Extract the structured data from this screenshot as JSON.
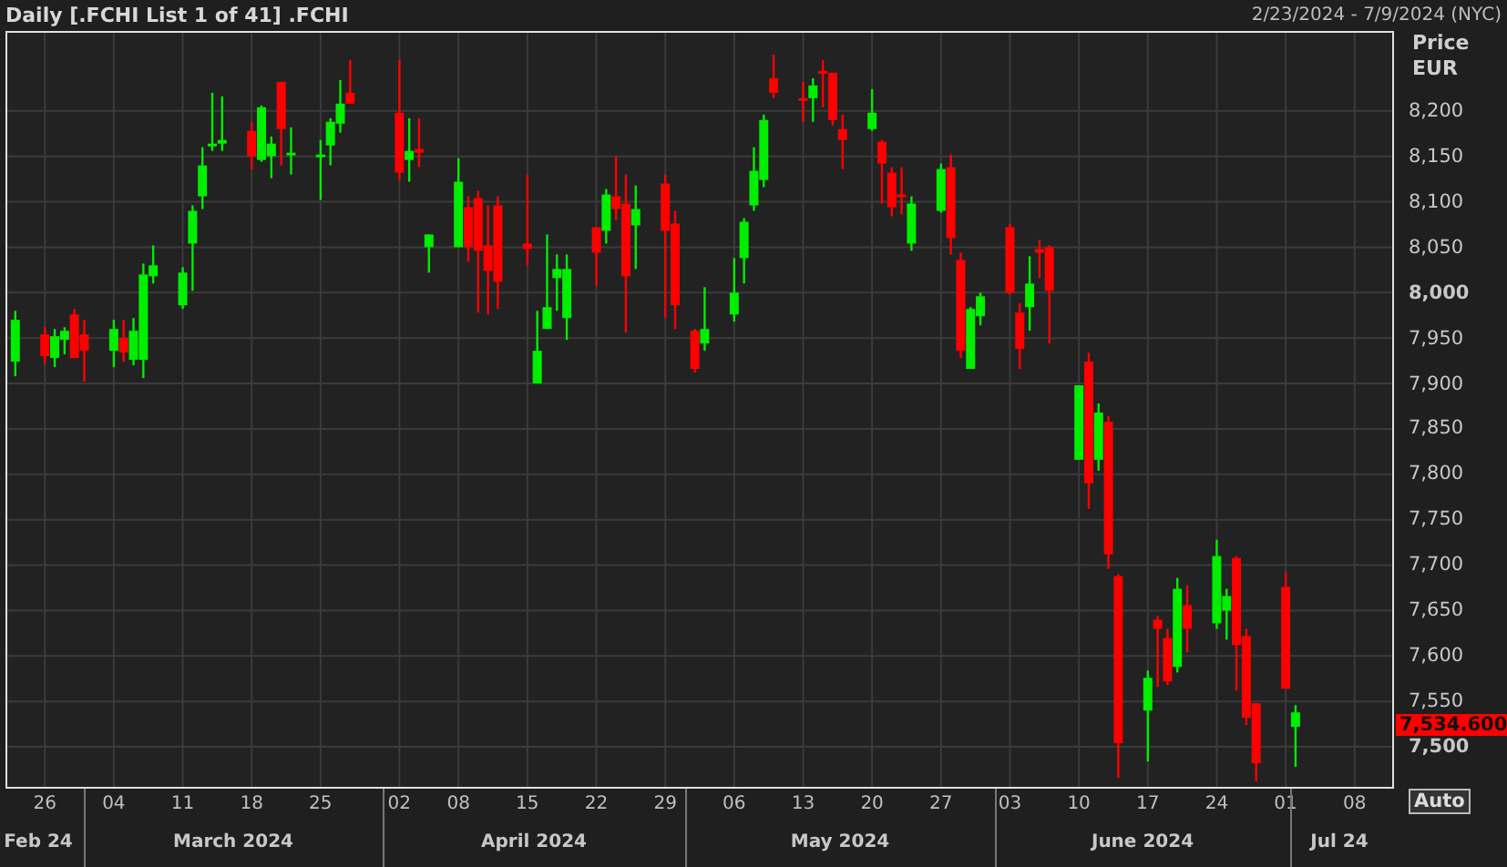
{
  "title": "Daily [.FCHI List 1 of 41] .FCHI",
  "date_range": "2/23/2024 - 7/9/2024 (NYC)",
  "price_axis": {
    "title": "Price",
    "unit": "EUR",
    "tick_styles": [
      {
        "emphasized": false
      },
      {
        "emphasized": false
      },
      {
        "emphasized": false
      },
      {
        "emphasized": false
      },
      {
        "emphasized": true
      },
      {
        "emphasized": false
      },
      {
        "emphasized": false
      },
      {
        "emphasized": false
      },
      {
        "emphasized": false
      },
      {
        "emphasized": false
      },
      {
        "emphasized": false
      },
      {
        "emphasized": false
      },
      {
        "emphasized": false
      },
      {
        "emphasized": false
      },
      {
        "emphasized": true
      }
    ]
  },
  "last_price": "7,534.600",
  "chart_data": {
    "type": "candlestick",
    "grid": true,
    "xlim": [
      "2024-02-22",
      "2024-07-12"
    ],
    "ylim": [
      7454,
      8288
    ],
    "yticks": [
      {
        "value": 8200,
        "label": "8,200"
      },
      {
        "value": 8150,
        "label": "8,150"
      },
      {
        "value": 8100,
        "label": "8,100"
      },
      {
        "value": 8050,
        "label": "8,050"
      },
      {
        "value": 8000,
        "label": "8,000"
      },
      {
        "value": 7950,
        "label": "7,950"
      },
      {
        "value": 7900,
        "label": "7,900"
      },
      {
        "value": 7850,
        "label": "7,850"
      },
      {
        "value": 7800,
        "label": "7,800"
      },
      {
        "value": 7750,
        "label": "7,750"
      },
      {
        "value": 7700,
        "label": "7,700"
      },
      {
        "value": 7650,
        "label": "7,650"
      },
      {
        "value": 7600,
        "label": "7,600"
      },
      {
        "value": 7550,
        "label": "7,550"
      },
      {
        "value": 7500,
        "label": "7,500"
      }
    ],
    "xticks": [
      {
        "value": "2024-02-26",
        "label": "26"
      },
      {
        "value": "2024-03-04",
        "label": "04"
      },
      {
        "value": "2024-03-11",
        "label": "11"
      },
      {
        "value": "2024-03-18",
        "label": "18"
      },
      {
        "value": "2024-03-25",
        "label": "25"
      },
      {
        "value": "2024-04-02",
        "label": "02"
      },
      {
        "value": "2024-04-08",
        "label": "08"
      },
      {
        "value": "2024-04-15",
        "label": "15"
      },
      {
        "value": "2024-04-22",
        "label": "22"
      },
      {
        "value": "2024-04-29",
        "label": "29"
      },
      {
        "value": "2024-05-06",
        "label": "06"
      },
      {
        "value": "2024-05-13",
        "label": "13"
      },
      {
        "value": "2024-05-20",
        "label": "20"
      },
      {
        "value": "2024-05-27",
        "label": "27"
      },
      {
        "value": "2024-06-03",
        "label": "03"
      },
      {
        "value": "2024-06-10",
        "label": "10"
      },
      {
        "value": "2024-06-17",
        "label": "17"
      },
      {
        "value": "2024-06-24",
        "label": "24"
      },
      {
        "value": "2024-07-01",
        "label": "01"
      },
      {
        "value": "2024-07-08",
        "label": "08"
      }
    ],
    "x": [
      "2024-02-23",
      "2024-02-26",
      "2024-02-27",
      "2024-02-28",
      "2024-02-29",
      "2024-03-01",
      "2024-03-04",
      "2024-03-05",
      "2024-03-06",
      "2024-03-07",
      "2024-03-08",
      "2024-03-11",
      "2024-03-12",
      "2024-03-13",
      "2024-03-14",
      "2024-03-15",
      "2024-03-18",
      "2024-03-19",
      "2024-03-20",
      "2024-03-21",
      "2024-03-22",
      "2024-03-25",
      "2024-03-26",
      "2024-03-27",
      "2024-03-28",
      "2024-04-02",
      "2024-04-03",
      "2024-04-04",
      "2024-04-05",
      "2024-04-08",
      "2024-04-09",
      "2024-04-10",
      "2024-04-11",
      "2024-04-12",
      "2024-04-15",
      "2024-04-16",
      "2024-04-17",
      "2024-04-18",
      "2024-04-19",
      "2024-04-22",
      "2024-04-23",
      "2024-04-24",
      "2024-04-25",
      "2024-04-26",
      "2024-04-29",
      "2024-04-30",
      "2024-05-02",
      "2024-05-03",
      "2024-05-06",
      "2024-05-07",
      "2024-05-08",
      "2024-05-09",
      "2024-05-10",
      "2024-05-13",
      "2024-05-14",
      "2024-05-15",
      "2024-05-16",
      "2024-05-17",
      "2024-05-20",
      "2024-05-21",
      "2024-05-22",
      "2024-05-23",
      "2024-05-24",
      "2024-05-27",
      "2024-05-28",
      "2024-05-29",
      "2024-05-30",
      "2024-05-31",
      "2024-06-03",
      "2024-06-04",
      "2024-06-05",
      "2024-06-06",
      "2024-06-07",
      "2024-06-10",
      "2024-06-11",
      "2024-06-12",
      "2024-06-13",
      "2024-06-14",
      "2024-06-17",
      "2024-06-18",
      "2024-06-19",
      "2024-06-20",
      "2024-06-21",
      "2024-06-24",
      "2024-06-25",
      "2024-06-26",
      "2024-06-27",
      "2024-06-28",
      "2024-07-01",
      "2024-07-02"
    ],
    "ohlc": [
      [
        7924,
        7980,
        7908,
        7970
      ],
      [
        7954,
        7962,
        7922,
        7930
      ],
      [
        7928,
        7960,
        7918,
        7952
      ],
      [
        7948,
        7962,
        7932,
        7958
      ],
      [
        7976,
        7982,
        7928,
        7928
      ],
      [
        7954,
        7970,
        7902,
        7936
      ],
      [
        7936,
        7970,
        7918,
        7960
      ],
      [
        7950,
        7970,
        7924,
        7934
      ],
      [
        7926,
        7972,
        7920,
        7958
      ],
      [
        7926,
        8032,
        7906,
        8020
      ],
      [
        8018,
        8052,
        8010,
        8030
      ],
      [
        7986,
        8028,
        7982,
        8022
      ],
      [
        8054,
        8096,
        8002,
        8090
      ],
      [
        8106,
        8160,
        8092,
        8140
      ],
      [
        8162,
        8220,
        8156,
        8164
      ],
      [
        8164,
        8216,
        8156,
        8168
      ],
      [
        8178,
        8188,
        8136,
        8150
      ],
      [
        8146,
        8206,
        8144,
        8204
      ],
      [
        8150,
        8172,
        8126,
        8164
      ],
      [
        8232,
        8232,
        8140,
        8180
      ],
      [
        8152,
        8182,
        8130,
        8154
      ],
      [
        8150,
        8168,
        8102,
        8152
      ],
      [
        8162,
        8192,
        8140,
        8188
      ],
      [
        8186,
        8234,
        8176,
        8208
      ],
      [
        8220,
        8256,
        8208,
        8208
      ],
      [
        8198,
        8256,
        8124,
        8132
      ],
      [
        8146,
        8192,
        8122,
        8156
      ],
      [
        8158,
        8192,
        8138,
        8154
      ],
      [
        8050,
        8064,
        8022,
        8064
      ],
      [
        8050,
        8148,
        8050,
        8122
      ],
      [
        8094,
        8106,
        8034,
        8050
      ],
      [
        8104,
        8112,
        7978,
        8046
      ],
      [
        8052,
        8096,
        7976,
        8024
      ],
      [
        8096,
        8106,
        7982,
        8012
      ],
      [
        8054,
        8130,
        8030,
        8048
      ],
      [
        7900,
        7980,
        7900,
        7936
      ],
      [
        7960,
        8064,
        7960,
        7984
      ],
      [
        8016,
        8042,
        7980,
        8026
      ],
      [
        7972,
        8042,
        7948,
        8026
      ],
      [
        8072,
        8072,
        8008,
        8044
      ],
      [
        8068,
        8114,
        8054,
        8108
      ],
      [
        8106,
        8150,
        8080,
        8092
      ],
      [
        8098,
        8130,
        7956,
        8018
      ],
      [
        8074,
        8118,
        8026,
        8092
      ],
      [
        8120,
        8130,
        7972,
        8068
      ],
      [
        8076,
        8090,
        7960,
        7986
      ],
      [
        7958,
        7960,
        7912,
        7916
      ],
      [
        7944,
        8006,
        7936,
        7960
      ],
      [
        7976,
        8038,
        7968,
        8000
      ],
      [
        8038,
        8082,
        8010,
        8078
      ],
      [
        8096,
        8160,
        8090,
        8134
      ],
      [
        8124,
        8196,
        8116,
        8190
      ],
      [
        8236,
        8262,
        8214,
        8220
      ],
      [
        8214,
        8232,
        8188,
        8212
      ],
      [
        8214,
        8236,
        8188,
        8228
      ],
      [
        8244,
        8256,
        8204,
        8242
      ],
      [
        8242,
        8242,
        8184,
        8190
      ],
      [
        8180,
        8196,
        8136,
        8168
      ],
      [
        8180,
        8224,
        8178,
        8198
      ],
      [
        8166,
        8168,
        8098,
        8142
      ],
      [
        8132,
        8138,
        8084,
        8094
      ],
      [
        8108,
        8138,
        8086,
        8106
      ],
      [
        8054,
        8106,
        8046,
        8098
      ],
      [
        8090,
        8142,
        8088,
        8136
      ],
      [
        8138,
        8152,
        8042,
        8060
      ],
      [
        8036,
        8044,
        7928,
        7936
      ],
      [
        7916,
        7984,
        7916,
        7982
      ],
      [
        7974,
        8000,
        7964,
        7996
      ],
      [
        8072,
        8076,
        7998,
        8000
      ],
      [
        7978,
        7988,
        7916,
        7938
      ],
      [
        7984,
        8040,
        7958,
        8010
      ],
      [
        8048,
        8058,
        8016,
        8044
      ],
      [
        8050,
        8052,
        7944,
        8002
      ],
      [
        7816,
        7898,
        7816,
        7898
      ],
      [
        7924,
        7934,
        7762,
        7790
      ],
      [
        7816,
        7878,
        7804,
        7868
      ],
      [
        7858,
        7864,
        7696,
        7712
      ],
      [
        7688,
        7690,
        7466,
        7504
      ],
      [
        7540,
        7584,
        7484,
        7576
      ],
      [
        7640,
        7644,
        7566,
        7630
      ],
      [
        7620,
        7630,
        7568,
        7572
      ],
      [
        7588,
        7686,
        7582,
        7674
      ],
      [
        7656,
        7678,
        7604,
        7630
      ],
      [
        7636,
        7728,
        7630,
        7710
      ],
      [
        7650,
        7674,
        7618,
        7666
      ],
      [
        7708,
        7710,
        7562,
        7612
      ],
      [
        7622,
        7630,
        7524,
        7532
      ],
      [
        7548,
        7548,
        7462,
        7482
      ],
      [
        7676,
        7692,
        7564,
        7564
      ],
      [
        7522,
        7546,
        7478,
        7538
      ]
    ]
  },
  "date_axis": {
    "months": [
      "Feb 24",
      "March 2024",
      "April 2024",
      "May 2024",
      "June 2024",
      "Jul 24"
    ]
  },
  "auto_button": "Auto"
}
